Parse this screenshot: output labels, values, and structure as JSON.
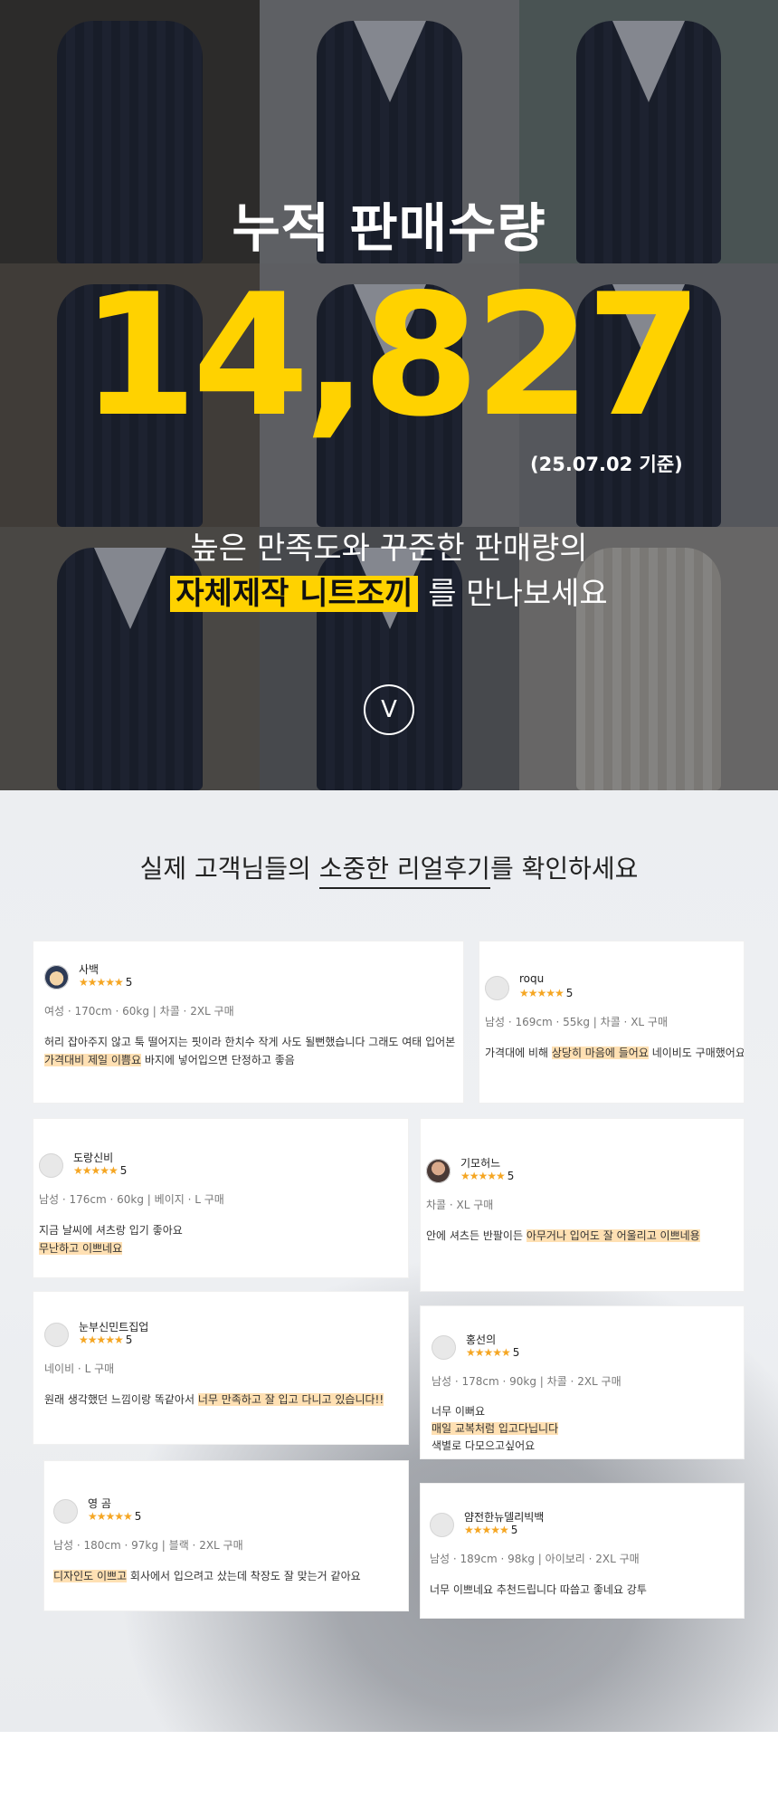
{
  "hero": {
    "title": "누적 판매수량",
    "count": "14,827",
    "basis": "(25.07.02 기준)",
    "sub_line1": "높은 만족도와 꾸준한 판매량의",
    "sub_highlight": "자체제작 니트조끼",
    "sub_rest": " 를 만나보세요",
    "down_icon": "chevron-down-icon",
    "down_glyph": "V"
  },
  "reviews_section": {
    "title_pre": "실제 고객님들의 ",
    "title_em": "소중한 리얼후기",
    "title_post": "를 확인하세요"
  },
  "reviews": [
    {
      "name": "사백",
      "stars": "★★★★★",
      "score": "5",
      "meta": "여성 · 170cm · 60kg  |  차콜 · 2XL 구매",
      "line1": "허리 잡아주지 않고 툭 떨어지는 핏이라 한치수 작게 사도 될뻔했습니다 그래도 여태 입어본",
      "line2_hl": "가격대비 제일 이쁨요",
      "line2_rest": " 바지에 넣어입으면 단정하고 좋음"
    },
    {
      "name": "roqu",
      "stars": "★★★★★",
      "score": "5",
      "meta": "남성 · 169cm · 55kg  |  차콜 · XL 구매",
      "line1_pre": "가격대에 비해 ",
      "line1_hl": "상당히 마음에 들어요",
      "line1_post": " 네이비도 구매했어요"
    },
    {
      "name": "도랑신비",
      "stars": "★★★★★",
      "score": "5",
      "meta": "남성 · 176cm · 60kg  |  베이지 · L 구매",
      "line1": "지금 날씨에 셔츠랑 입기 좋아요",
      "line2_hl": "무난하고 이쁘네요"
    },
    {
      "name": "기모허느",
      "stars": "★★★★★",
      "score": "5",
      "meta": "차콜 · XL 구매",
      "line1_pre": "안에 셔츠든 반팔이든 ",
      "line1_hl": "아무거나 입어도 잘 어울리고 이쁘네용"
    },
    {
      "name": "눈부신민트집업",
      "stars": "★★★★★",
      "score": "5",
      "meta": "네이비 · L 구매",
      "line1_pre": "원래 생각했던 느낌이랑 똑같아서 ",
      "line1_hl": "너무 만족하고 잘 입고 다니고 있습니다!!"
    },
    {
      "name": "홍선의",
      "stars": "★★★★★",
      "score": "5",
      "meta": "남성 · 178cm · 90kg  |  차콜 · 2XL 구매",
      "line1": "너무 이뻐요",
      "line2_hl": "매일 교복처럼 입고다닙니다",
      "line3": "색별로 다모으고싶어요"
    },
    {
      "name": "영 곰",
      "stars": "★★★★★",
      "score": "5",
      "meta": "남성 · 180cm · 97kg  |  블랙 · 2XL 구매",
      "line1_hl": "디자인도 이쁘고",
      "line1_post": " 회사에서 입으려고 샀는데 착장도 잘 맞는거 같아요"
    },
    {
      "name": "얌전한뉴델리빅백",
      "stars": "★★★★★",
      "score": "5",
      "meta": "남성 · 189cm · 98kg  |  아이보리 · 2XL 구매",
      "line1": "너무 이쁘네요 추천드립니다 따씁고 좋네요 강투"
    }
  ]
}
